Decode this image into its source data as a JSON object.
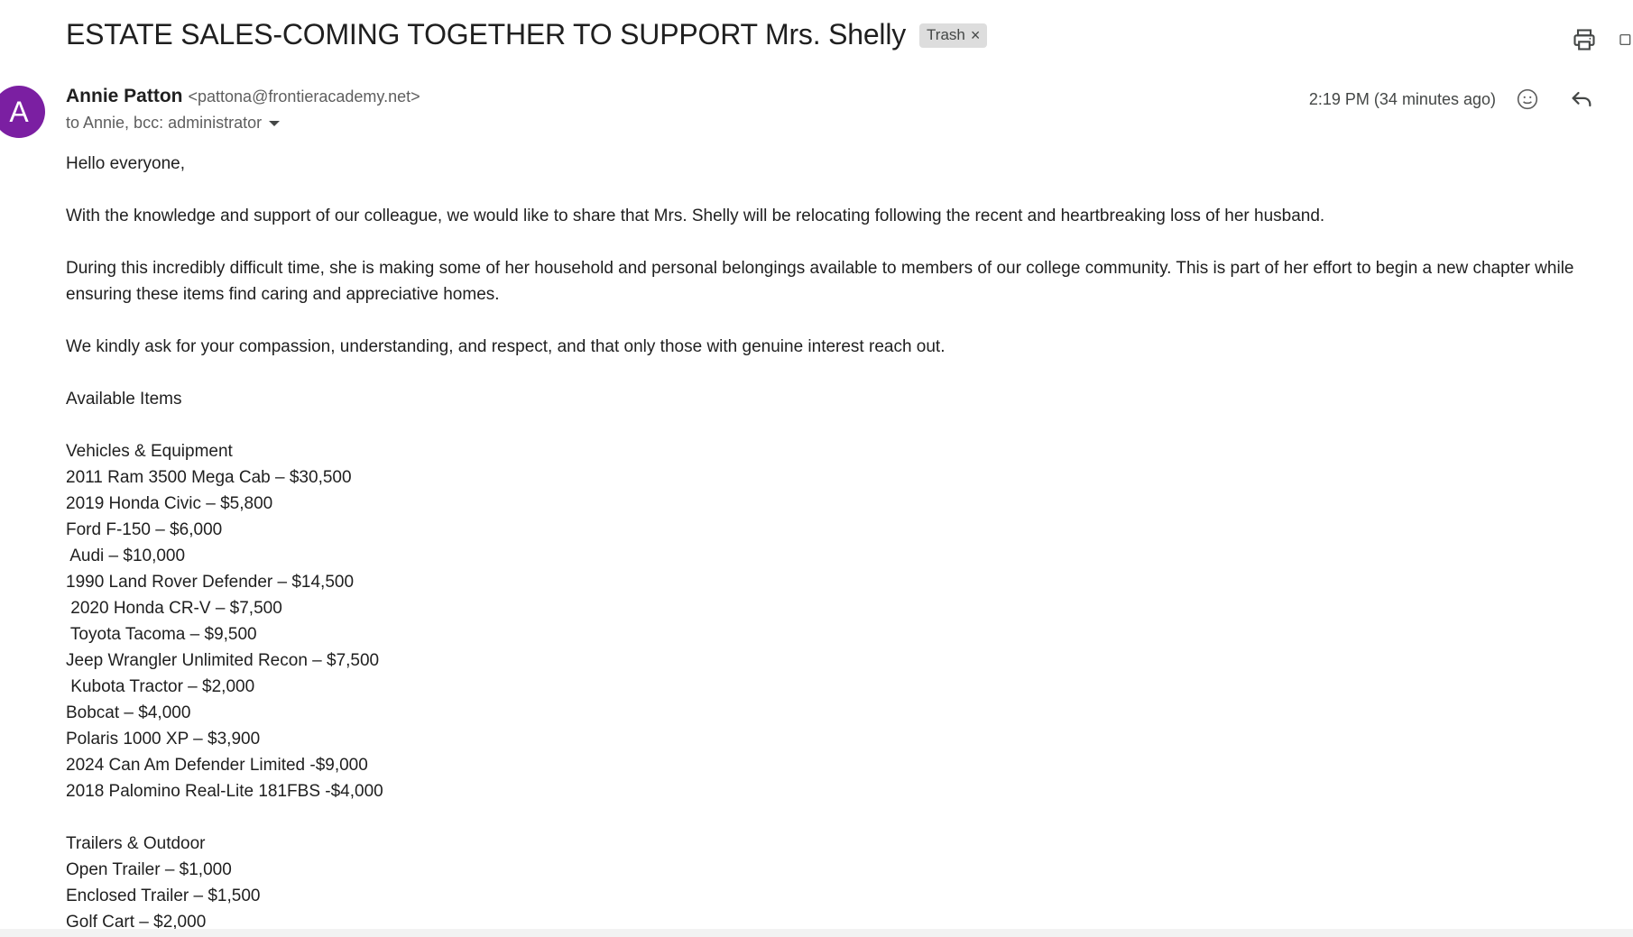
{
  "email": {
    "subject": "ESTATE SALES-COMING TOGETHER TO SUPPORT Mrs. Shelly",
    "label": "Trash",
    "label_remove": "×",
    "sender_initial": "A",
    "sender_name": "Annie Patton",
    "sender_email": "<pattona@frontieracademy.net>",
    "recipients": "to Annie, bcc: administrator",
    "timestamp": "2:19 PM (34 minutes ago)"
  },
  "icons": {
    "print": "print-icon",
    "open_new_window": "open-in-new-window-icon",
    "emoji": "emoji-reaction-icon",
    "reply": "reply-icon",
    "recipients_expand": "chevron-down-icon"
  },
  "colors": {
    "avatar": "#7b1fa2",
    "chip_bg": "#dddddd",
    "text": "#1f1f1f",
    "muted": "#5e5e5e"
  },
  "body": {
    "greeting": "Hello everyone,",
    "paragraph1": "With the knowledge and support of our colleague, we would like to share that Mrs. Shelly will be relocating following the recent and heartbreaking loss of her husband.",
    "paragraph2": "During this incredibly difficult time, she is making some of her household and personal belongings available to members of our college community. This is part of her effort to begin a new chapter while ensuring these items find caring and appreciative homes.",
    "paragraph3": "We kindly ask for your compassion, understanding, and respect, and that only those with genuine interest reach out.",
    "available_heading": "Available Items",
    "sections": [
      {
        "title": "Vehicles & Equipment",
        "items": [
          "2011 Ram 3500 Mega Cab – $30,500",
          "2019 Honda Civic – $5,800",
          "Ford F-150 – $6,000",
          " Audi – $10,000",
          "1990 Land Rover Defender – $14,500",
          " 2020 Honda CR-V – $7,500",
          " Toyota Tacoma – $9,500",
          "Jeep Wrangler Unlimited Recon – $7,500",
          " Kubota Tractor – $2,000",
          "Bobcat – $4,000",
          "Polaris 1000 XP – $3,900",
          "2024 Can Am Defender Limited -$9,000",
          "2018 Palomino Real-Lite 181FBS -$4,000"
        ]
      },
      {
        "title": "Trailers & Outdoor",
        "items": [
          "Open Trailer – $1,000",
          "Enclosed Trailer – $1,500",
          "Golf Cart – $2,000"
        ]
      }
    ]
  }
}
